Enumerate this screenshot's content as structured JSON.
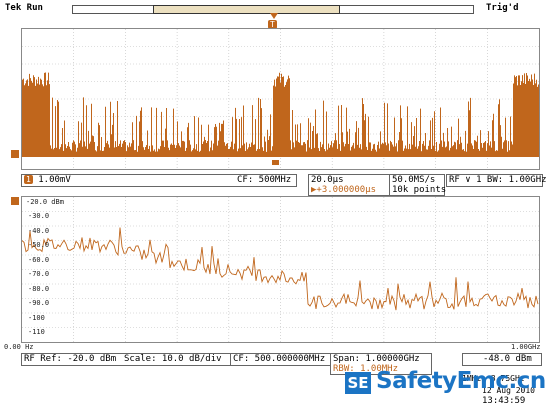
{
  "header": {
    "brand": "Tek Run",
    "status": "Trig'd"
  },
  "trigger_marker": "T",
  "time_panel": {
    "channel": "1.00mV",
    "cf": "CF: 500MHz",
    "timebase": "20.0µs",
    "delay": "▶+3.000000µs",
    "sample_rate": "50.0MS/s",
    "record_length": "10k points",
    "rf_bw": "RF ∨ 1 BW: 1.00GHz"
  },
  "freq_panel": {
    "top_label": "-20.0 dBm",
    "y_labels": [
      "-30.0",
      "-40.0",
      "-50.0",
      "-60.0",
      "-70.0",
      "-80.0",
      "-90.0",
      "-100",
      "-110"
    ],
    "x_start": "0.00 Hz",
    "x_end": "1.00GHz",
    "ref": "RF  Ref: -20.0 dBm",
    "scale": "Scale: 10.0 dB/div",
    "cf": "CF: 500.000000MHz",
    "span": "Span:  1.00000GHz",
    "rbw": "RBW:  1.00MHz",
    "marker": "-48.0 dBm",
    "freq_readout": "1MHz: 3.75GHz",
    "date": "12 Aug 2010",
    "time": "13:43:59"
  },
  "watermark": {
    "prefix": "SE",
    "text": "SafetyEmc.cn"
  },
  "colors": {
    "trace": "#c0661c",
    "grid": "#bdbdbd",
    "watermark": "#1b74c4"
  }
}
